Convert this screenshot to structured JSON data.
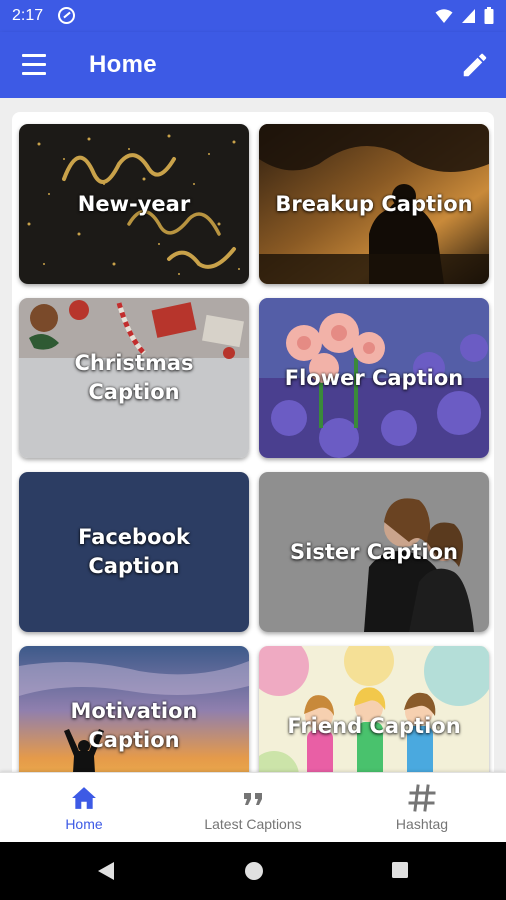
{
  "status_bar": {
    "time": "2:17"
  },
  "app_bar": {
    "title": "Home"
  },
  "colors": {
    "primary": "#3d5ae5",
    "inactive": "#757575"
  },
  "categories": [
    {
      "label": "New-year",
      "theme": "dark-gold-sparkle"
    },
    {
      "label": "Breakup Caption",
      "theme": "sunset-silhouette"
    },
    {
      "label": "Christmas Caption",
      "theme": "gifts-on-grey"
    },
    {
      "label": "Flower Caption",
      "theme": "pink-purple-flowers"
    },
    {
      "label": "Facebook Caption",
      "theme": "navy"
    },
    {
      "label": "Sister Caption",
      "theme": "grey-hug"
    },
    {
      "label": "Motivation Caption",
      "theme": "sunset-sky"
    },
    {
      "label": "Friend Caption",
      "theme": "watercolor-friends"
    }
  ],
  "bottom_nav": {
    "items": [
      {
        "label": "Home",
        "icon": "home-icon",
        "active": true
      },
      {
        "label": "Latest Captions",
        "icon": "quote-icon",
        "active": false
      },
      {
        "label": "Hashtag",
        "icon": "hashtag-icon",
        "active": false
      }
    ]
  }
}
